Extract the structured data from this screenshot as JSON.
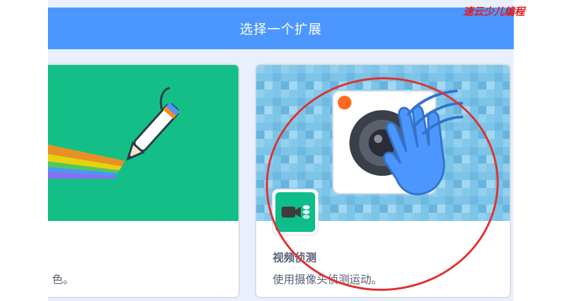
{
  "header": {
    "title": "选择一个扩展"
  },
  "cards": {
    "left": {
      "description_fragment": "色。"
    },
    "right": {
      "title": "视频侦测",
      "description": "使用摄像头侦测运动。"
    }
  },
  "watermark": {
    "text": "速云少儿编程"
  },
  "colors": {
    "header": "#4c97ff",
    "background": "#e9f0fc",
    "pen_card": "#13bf86",
    "video_icon": "#0fbd8c",
    "annotation": "#e0312e"
  },
  "icons": [
    "pen-icon",
    "video-sensing-icon",
    "camera-icon",
    "waving-hand-icon"
  ]
}
